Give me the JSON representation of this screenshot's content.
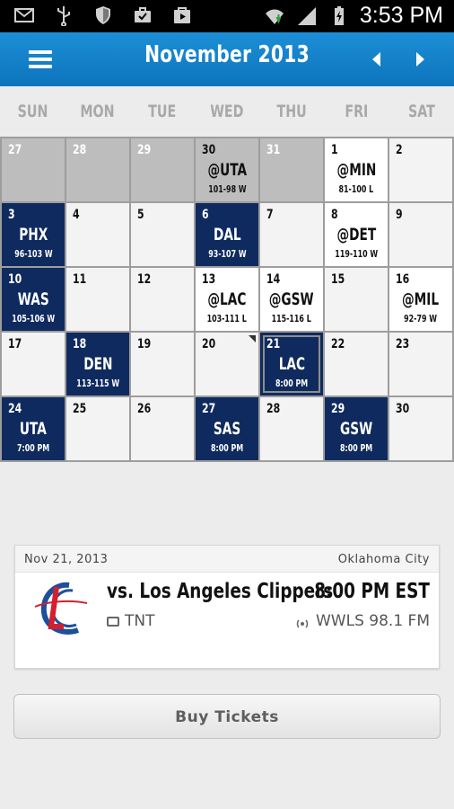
{
  "status_bar": {
    "time": "3:53 PM",
    "icons": [
      "mail-icon",
      "usb-icon",
      "shield-icon",
      "briefcase-check-icon",
      "play-store-icon",
      "wifi-icon",
      "signal-icon",
      "battery-charging-icon"
    ]
  },
  "header": {
    "title": "November 2013",
    "menu_icon": "hamburger-icon",
    "prev_icon": "arrow-left-icon",
    "next_icon": "arrow-right-icon"
  },
  "weekdays": [
    "SUN",
    "MON",
    "TUE",
    "WED",
    "THU",
    "FRI",
    "SAT"
  ],
  "calendar": {
    "days": [
      {
        "day": "27",
        "type": "other",
        "opp": "",
        "res": ""
      },
      {
        "day": "28",
        "type": "other",
        "opp": "",
        "res": ""
      },
      {
        "day": "29",
        "type": "other",
        "opp": "",
        "res": ""
      },
      {
        "day": "30",
        "type": "other away",
        "opp": "@UTA",
        "res": "101-98 W"
      },
      {
        "day": "31",
        "type": "other",
        "opp": "",
        "res": ""
      },
      {
        "day": "1",
        "type": "away",
        "opp": "@MIN",
        "res": "81-100 L"
      },
      {
        "day": "2",
        "type": "normal",
        "opp": "",
        "res": ""
      },
      {
        "day": "3",
        "type": "home",
        "opp": "PHX",
        "res": "96-103 W"
      },
      {
        "day": "4",
        "type": "normal",
        "opp": "",
        "res": ""
      },
      {
        "day": "5",
        "type": "normal",
        "opp": "",
        "res": ""
      },
      {
        "day": "6",
        "type": "home",
        "opp": "DAL",
        "res": "93-107 W"
      },
      {
        "day": "7",
        "type": "normal",
        "opp": "",
        "res": ""
      },
      {
        "day": "8",
        "type": "away",
        "opp": "@DET",
        "res": "119-110 W"
      },
      {
        "day": "9",
        "type": "normal",
        "opp": "",
        "res": ""
      },
      {
        "day": "10",
        "type": "home",
        "opp": "WAS",
        "res": "105-106 W"
      },
      {
        "day": "11",
        "type": "normal",
        "opp": "",
        "res": ""
      },
      {
        "day": "12",
        "type": "normal",
        "opp": "",
        "res": ""
      },
      {
        "day": "13",
        "type": "away",
        "opp": "@LAC",
        "res": "103-111 L"
      },
      {
        "day": "14",
        "type": "away",
        "opp": "@GSW",
        "res": "115-116 L"
      },
      {
        "day": "15",
        "type": "normal",
        "opp": "",
        "res": ""
      },
      {
        "day": "16",
        "type": "away",
        "opp": "@MIL",
        "res": "92-79 W"
      },
      {
        "day": "17",
        "type": "normal",
        "opp": "",
        "res": ""
      },
      {
        "day": "18",
        "type": "home",
        "opp": "DEN",
        "res": "113-115 W"
      },
      {
        "day": "19",
        "type": "normal",
        "opp": "",
        "res": ""
      },
      {
        "day": "20",
        "type": "normal corner",
        "opp": "",
        "res": ""
      },
      {
        "day": "21",
        "type": "today",
        "opp": "LAC",
        "res": "8:00 PM"
      },
      {
        "day": "22",
        "type": "normal",
        "opp": "",
        "res": ""
      },
      {
        "day": "23",
        "type": "normal",
        "opp": "",
        "res": ""
      },
      {
        "day": "24",
        "type": "home",
        "opp": "UTA",
        "res": "7:00 PM"
      },
      {
        "day": "25",
        "type": "normal",
        "opp": "",
        "res": ""
      },
      {
        "day": "26",
        "type": "normal",
        "opp": "",
        "res": ""
      },
      {
        "day": "27",
        "type": "home",
        "opp": "SAS",
        "res": "8:00 PM"
      },
      {
        "day": "28",
        "type": "normal",
        "opp": "",
        "res": ""
      },
      {
        "day": "29",
        "type": "home",
        "opp": "GSW",
        "res": "8:00 PM"
      },
      {
        "day": "30",
        "type": "normal",
        "opp": "",
        "res": ""
      }
    ]
  },
  "game_card": {
    "date": "Nov 21, 2013",
    "city": "Oklahoma City",
    "opponent": "vs. Los Angeles Clippers",
    "time": "8:00 PM EST",
    "tv": "TNT",
    "radio": "WWLS 98.1 FM",
    "logo_icon": "clippers-logo-icon"
  },
  "buy_tickets": "Buy Tickets",
  "colors": {
    "header_blue": "#0c74bd",
    "home_navy": "#0f2a5e",
    "other_month_gray": "#bdbdbd"
  }
}
